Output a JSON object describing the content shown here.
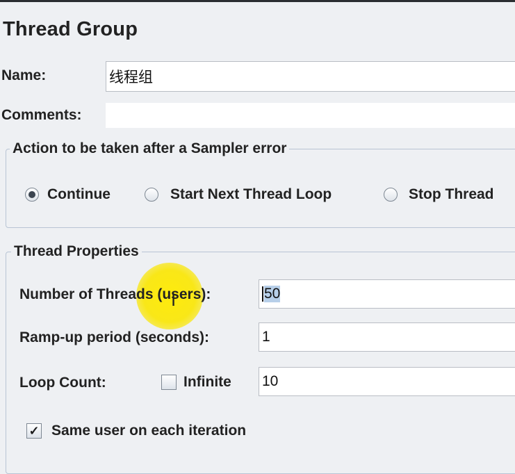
{
  "title": "Thread Group",
  "name": {
    "label": "Name:",
    "value": "线程组"
  },
  "comments": {
    "label": "Comments:",
    "value": ""
  },
  "sampler_error": {
    "legend": "Action to be taken after a Sampler error",
    "options": [
      {
        "label": "Continue",
        "selected": true
      },
      {
        "label": "Start Next Thread Loop",
        "selected": false
      },
      {
        "label": "Stop Thread",
        "selected": false
      }
    ]
  },
  "thread_properties": {
    "legend": "Thread Properties",
    "num_threads": {
      "label": "Number of Threads (users):",
      "value": "50"
    },
    "ramp_up": {
      "label": "Ramp-up period (seconds):",
      "value": "1"
    },
    "loop_count": {
      "label": "Loop Count:",
      "infinite_label": "Infinite",
      "infinite_checked": false,
      "value": "10"
    },
    "same_user": {
      "label": "Same user on each iteration",
      "checked": true,
      "check_glyph": "✓"
    }
  },
  "colors": {
    "background": "#eef0f3",
    "highlight": "#ffeb00",
    "selection": "#b7cfe9"
  }
}
